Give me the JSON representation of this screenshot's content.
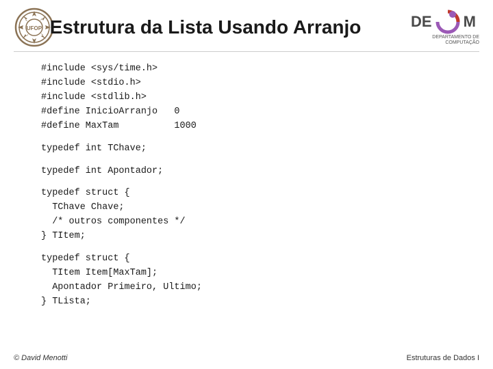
{
  "slide": {
    "title": "Estrutura da Lista Usando Arranjo",
    "code_sections": [
      {
        "id": "includes",
        "lines": [
          "#include <sys/time.h>",
          "#include <stdio.h>",
          "#include <stdlib.h>",
          "#define InicioArranjo   0",
          "#define MaxTam          1000"
        ]
      },
      {
        "id": "typedef_tchave",
        "lines": [
          "typedef int TChave;"
        ]
      },
      {
        "id": "typedef_apontador",
        "lines": [
          "typedef int Apontador;"
        ]
      },
      {
        "id": "typedef_titem",
        "lines": [
          "typedef struct {",
          "  TChave Chave;",
          "  /* outros componentes */",
          "} TItem;"
        ]
      },
      {
        "id": "typedef_tlista",
        "lines": [
          "typedef struct {",
          "  TItem Item[MaxTam];",
          "  Apontador Primeiro, Ultimo;",
          "} TLista;"
        ]
      }
    ],
    "footer": {
      "left": "© David Menotti",
      "right": "Estruturas de Dados I"
    }
  }
}
